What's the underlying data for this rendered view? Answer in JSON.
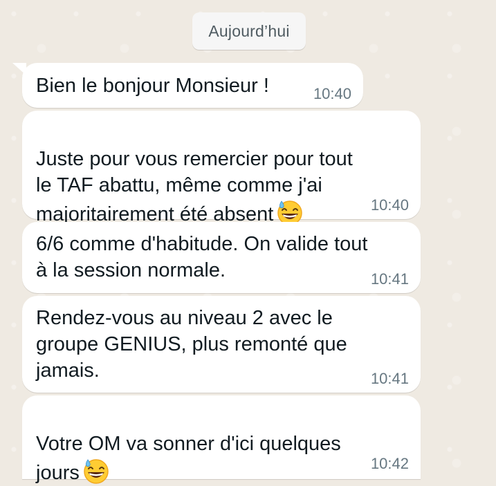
{
  "date_separator": "Aujourd’hui",
  "messages": [
    {
      "text": "Bien le bonjour Monsieur !",
      "time": "10:40"
    },
    {
      "text": "Juste pour vous remercier pour tout\nle TAF abattu, même comme j'ai\nmajoritairement été absent",
      "time": "10:40",
      "emoji": "grinning-sweat-emoji"
    },
    {
      "text": "6/6 comme d'habitude. On valide tout\nà la session normale.",
      "time": "10:41"
    },
    {
      "text": "Rendez-vous au niveau 2 avec le\ngroupe GENIUS, plus remonté que\njamais.",
      "time": "10:41"
    },
    {
      "text": "Votre OM va sonner d'ici quelques\njours",
      "time": "10:42",
      "emoji": "grinning-sweat-emoji"
    }
  ],
  "colors": {
    "chat_background": "#efeae2",
    "bubble": "#ffffff",
    "text": "#111b21",
    "timestamp": "#667781",
    "date_chip": "#f6f6f6"
  }
}
